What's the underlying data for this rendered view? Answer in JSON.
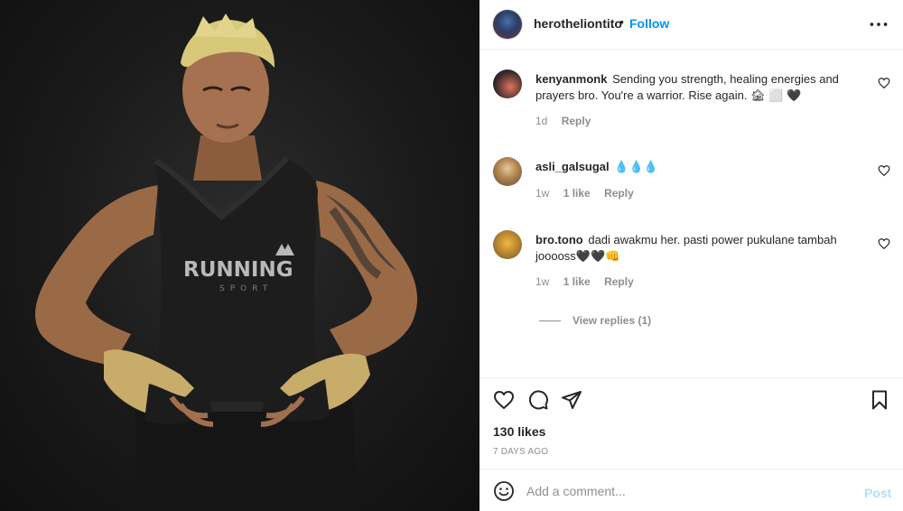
{
  "post": {
    "username": "herotheliontito",
    "separator": "•",
    "follow_label": "Follow",
    "more_icon": "more-horizontal-icon",
    "photo": {
      "vest_brand": "RUNNING",
      "vest_sub": "SPORT"
    }
  },
  "comments": [
    {
      "username": "kenyanmonk",
      "text": "Sending you strength, healing energies and prayers bro. You're a warrior. Rise again. 🏚 ⬜ 🖤",
      "time": "1d",
      "likes": "",
      "reply_label": "Reply"
    },
    {
      "username": "asli_galsugal",
      "text": "💧💧💧",
      "time": "1w",
      "likes": "1 like",
      "reply_label": "Reply"
    },
    {
      "username": "bro.tono",
      "text": "dadi awakmu her. pasti power pukulane tambah jooooss🖤🖤👊",
      "time": "1w",
      "likes": "1 like",
      "reply_label": "Reply"
    }
  ],
  "view_replies_label": "View replies (1)",
  "actions": {
    "like_icon": "heart-icon",
    "comment_icon": "comment-icon",
    "share_icon": "paper-plane-icon",
    "save_icon": "bookmark-icon"
  },
  "likes_text": "130 likes",
  "age_text": "7 DAYS AGO",
  "add_comment": {
    "placeholder": "Add a comment...",
    "post_label": "Post",
    "emoji_icon": "smiley-icon"
  },
  "colors": {
    "accent": "#0095f6",
    "post_disabled": "#b2dffc",
    "muted": "#8e8e8e",
    "text": "#262626"
  }
}
